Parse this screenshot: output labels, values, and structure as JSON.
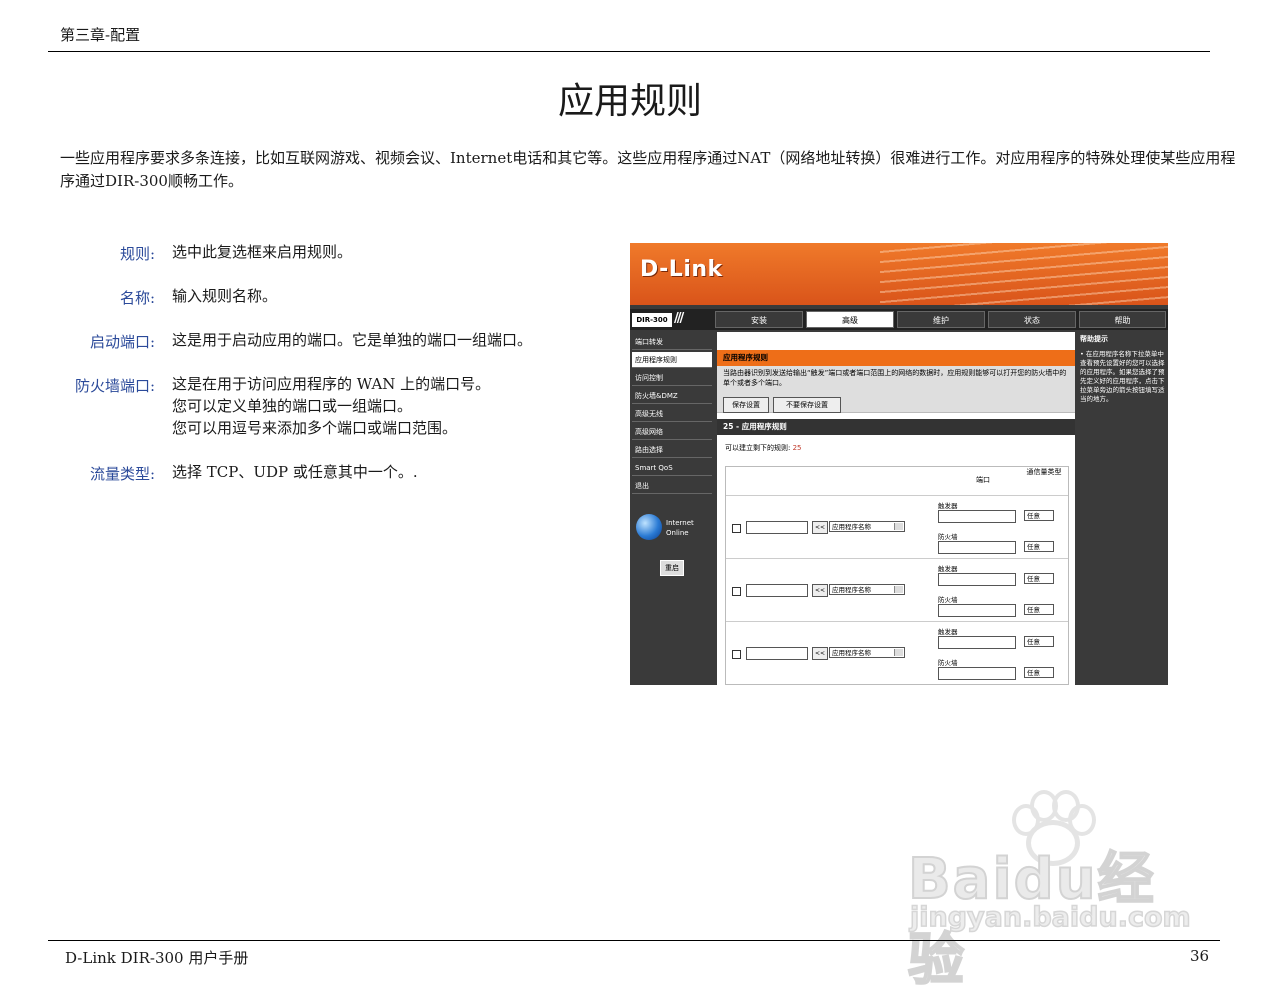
{
  "header": {
    "chapter": "第三章-配置"
  },
  "title": "应用规则",
  "intro": "一些应用程序要求多条连接，比如互联网游戏、视频会议、Internet电话和其它等。这些应用程序通过NAT（网络地址转换）很难进行工作。对应用程序的特殊处理使某些应用程序通过DIR-300顺畅工作。",
  "definitions": [
    {
      "term": "规则:",
      "lines": [
        "选中此复选框来启用规则。"
      ]
    },
    {
      "term": "名称:",
      "lines": [
        "输入规则名称。"
      ]
    },
    {
      "term": "启动端口:",
      "lines": [
        "这是用于启动应用的端口。它是单独的端口一组端口。"
      ]
    },
    {
      "term": "防火墙端口:",
      "lines": [
        "这是在用于访问应用程序的 WAN 上的端口号。",
        "您可以定义单独的端口或一组端口。",
        "您可以用逗号来添加多个端口或端口范围。"
      ]
    },
    {
      "term": "流量类型:",
      "lines": [
        "选择 TCP、UDP 或任意其中一个。."
      ]
    }
  ],
  "screenshot": {
    "brand": "D-Link",
    "model": "DIR-300",
    "nav_tabs": [
      "安装",
      "高级",
      "维护",
      "状态",
      "帮助"
    ],
    "sidebar": [
      "端口转发",
      "应用程序规则",
      "访问控制",
      "防火墙&DMZ",
      "高级无线",
      "高级网络",
      "路由选择",
      "Smart QoS",
      "退出"
    ],
    "internet_status": [
      "Internet",
      "Online"
    ],
    "reboot_label": "重启",
    "section_title": "应用程序规则",
    "section_text": "当路由器识别到发送给输出“触发”端口或者端口范围上的网络的数据时，应用规则能够可以打开您的防火墙中的单个或者多个端口。",
    "save_button": "保存设置",
    "dont_save_button": "不要保存设置",
    "rules_title": "25 - 应用程序规则",
    "rules_left_label": "可以建立剩下的规则:",
    "rules_left_count": "25",
    "col_port": "端口",
    "col_type": "通信量类型",
    "arrow": "<<",
    "app_select": "应用程序名称",
    "trigger_label": "触发器",
    "firewall_label": "防火墙",
    "type_value": "任意",
    "help_title": "帮助提示",
    "help_text": "• 在应用程序名称下拉菜单中查看预先设置好的您可以选择的应用程序。如果您选择了预先定义好的应用程序，点击下拉菜单旁边的箭头按钮填写适当的地方。"
  },
  "watermark": {
    "brand": "Baidu经验",
    "url": "jingyan.baidu.com"
  },
  "footer": {
    "manual": "D-Link DIR-300 用户手册",
    "page": "36"
  }
}
